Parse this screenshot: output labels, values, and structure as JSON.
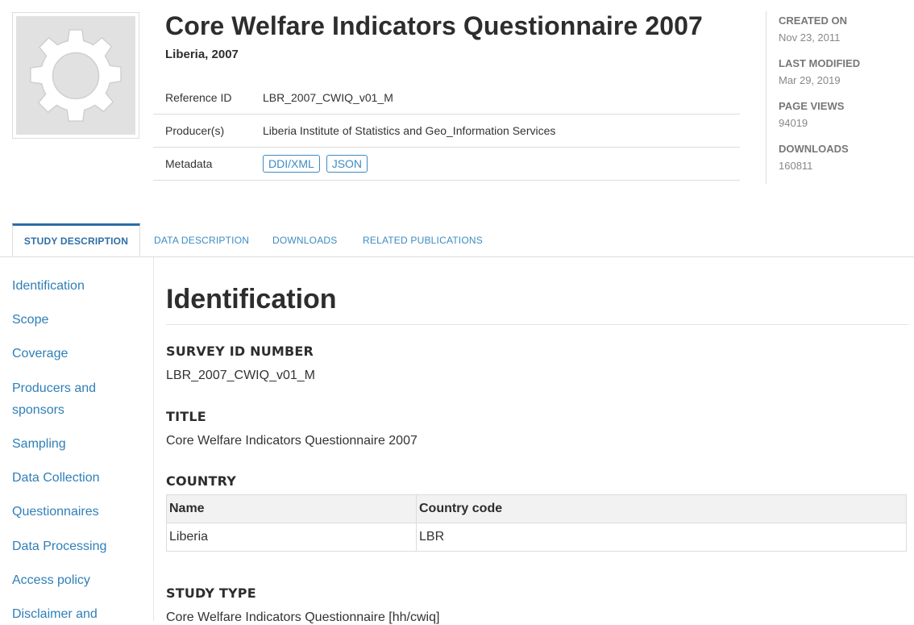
{
  "header": {
    "title": "Core Welfare Indicators Questionnaire 2007",
    "subtitle": "Liberia, 2007",
    "thumbnail_icon": "gear-icon",
    "rows": [
      {
        "label": "Reference ID",
        "value": "LBR_2007_CWIQ_v01_M"
      },
      {
        "label": "Producer(s)",
        "value": "Liberia Institute of Statistics and Geo_Information Services"
      },
      {
        "label": "Metadata",
        "tags": [
          "DDI/XML",
          "JSON"
        ]
      }
    ]
  },
  "stats": {
    "created_label": "CREATED ON",
    "created_value": "Nov 23, 2011",
    "modified_label": "LAST MODIFIED",
    "modified_value": "Mar 29, 2019",
    "views_label": "PAGE VIEWS",
    "views_value": "94019",
    "downloads_label": "DOWNLOADS",
    "downloads_value": "160811"
  },
  "tabs": [
    {
      "label": "STUDY DESCRIPTION",
      "active": true
    },
    {
      "label": "DATA DESCRIPTION",
      "active": false
    },
    {
      "label": "DOWNLOADS",
      "active": false
    },
    {
      "label": "RELATED PUBLICATIONS",
      "active": false
    }
  ],
  "sidebar": {
    "items": [
      "Identification",
      "Scope",
      "Coverage",
      "Producers and sponsors",
      "Sampling",
      "Data Collection",
      "Questionnaires",
      "Data Processing",
      "Access policy",
      "Disclaimer and"
    ]
  },
  "content": {
    "heading": "Identification",
    "survey_id_label": "SURVEY ID NUMBER",
    "survey_id_value": "LBR_2007_CWIQ_v01_M",
    "title_label": "TITLE",
    "title_value": "Core Welfare Indicators Questionnaire 2007",
    "country_label": "COUNTRY",
    "country_table": {
      "headers": [
        "Name",
        "Country code"
      ],
      "rows": [
        [
          "Liberia",
          "LBR"
        ]
      ]
    },
    "study_type_label": "STUDY TYPE",
    "study_type_value": "Core Welfare Indicators Questionnaire [hh/cwiq]"
  },
  "colors": {
    "link": "#3d8bc2",
    "active_tab": "#2e6ea5",
    "heading": "#2d2d2d"
  }
}
